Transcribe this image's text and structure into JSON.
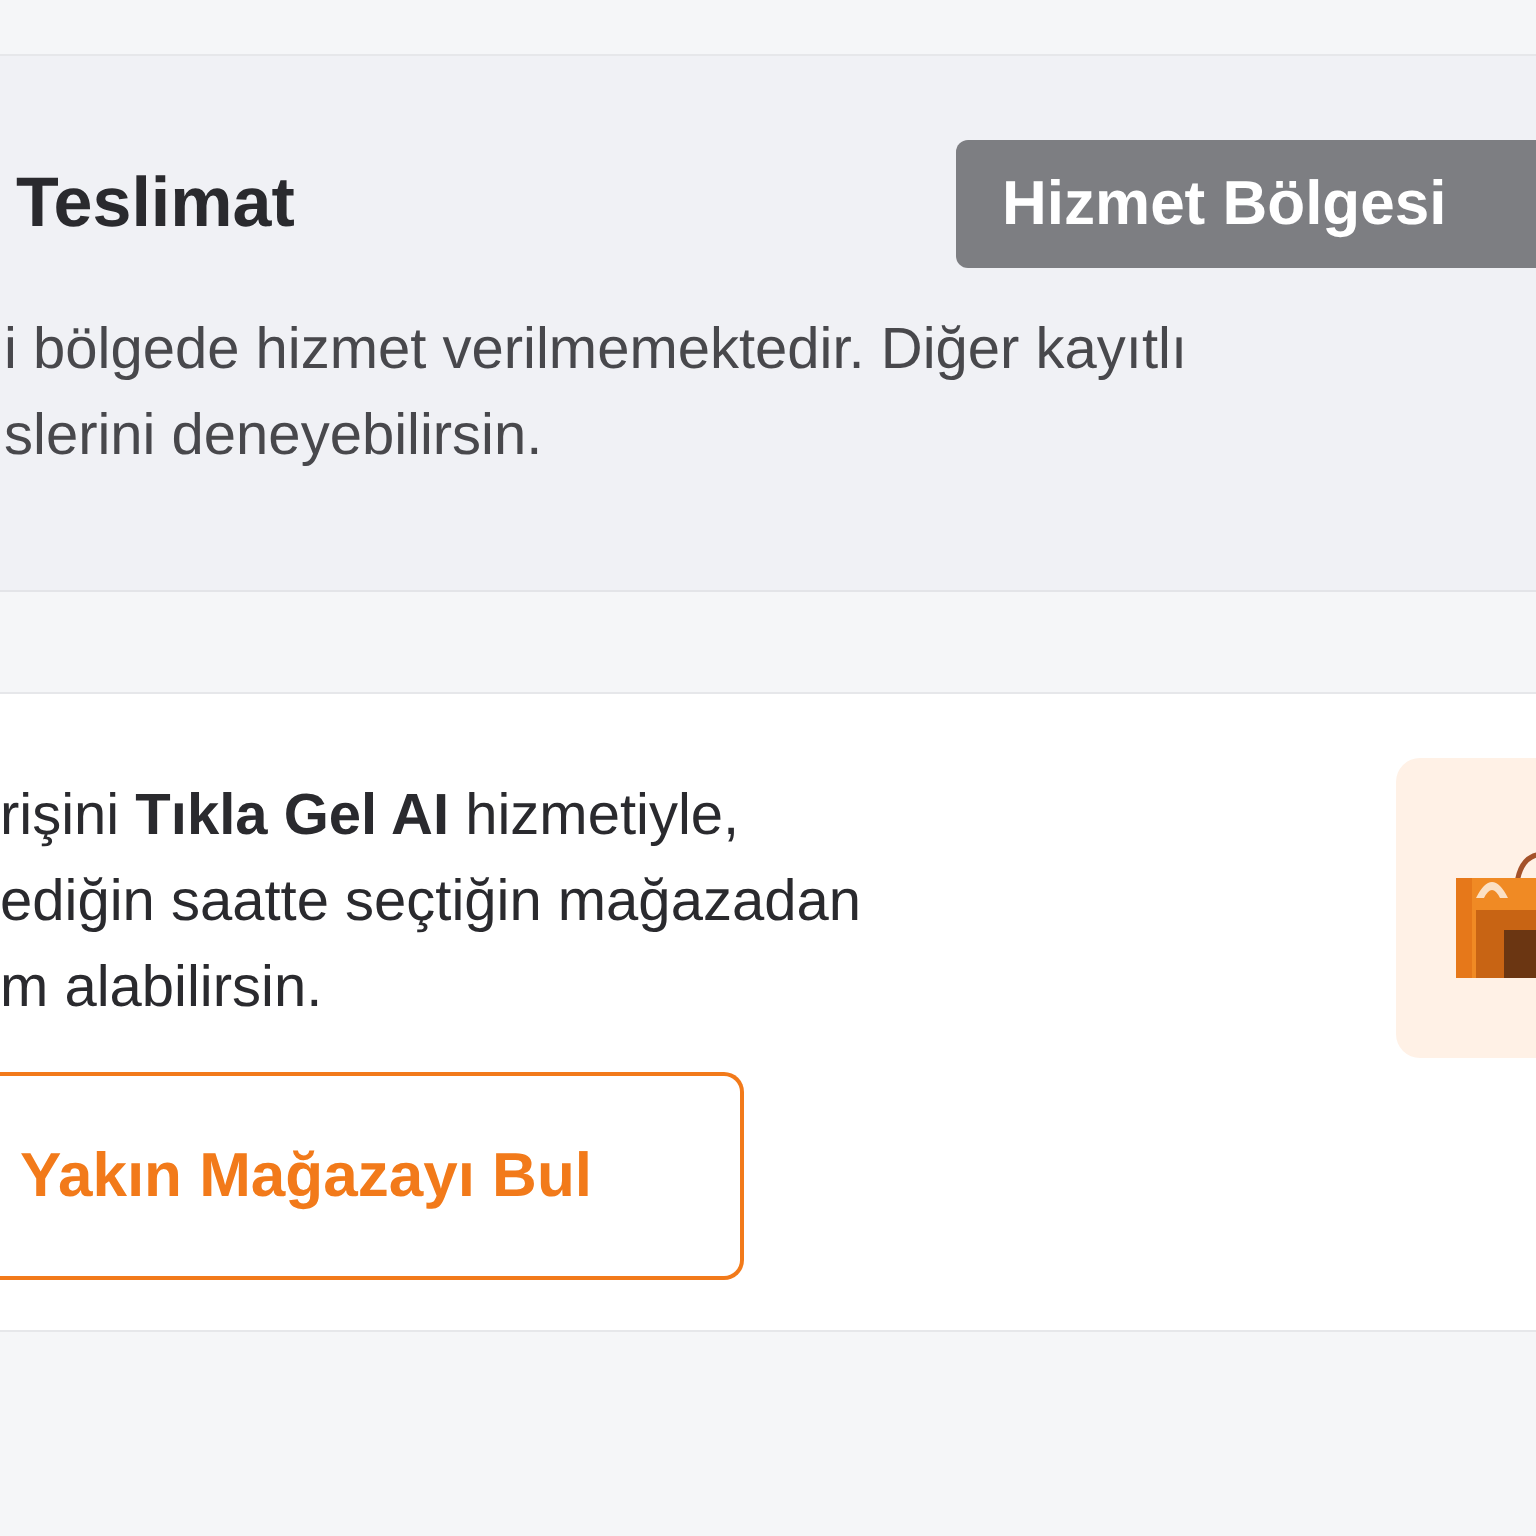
{
  "delivery_section": {
    "title": "Teslimat",
    "region_button": "Hizmet Bölgesi",
    "message_lines": [
      "i bölgede hizmet verilmemektedir. Diğer kayıtlı",
      "slerini deneyebilirsin."
    ]
  },
  "pickup_card": {
    "message_lines": [
      "rişini **Tıkla Gel AI** hizmetiyle,",
      "ediğin saatte seçtiğin mağazadan",
      "m alabilirsin."
    ],
    "button": "Yakın Mağazayı Bul"
  }
}
